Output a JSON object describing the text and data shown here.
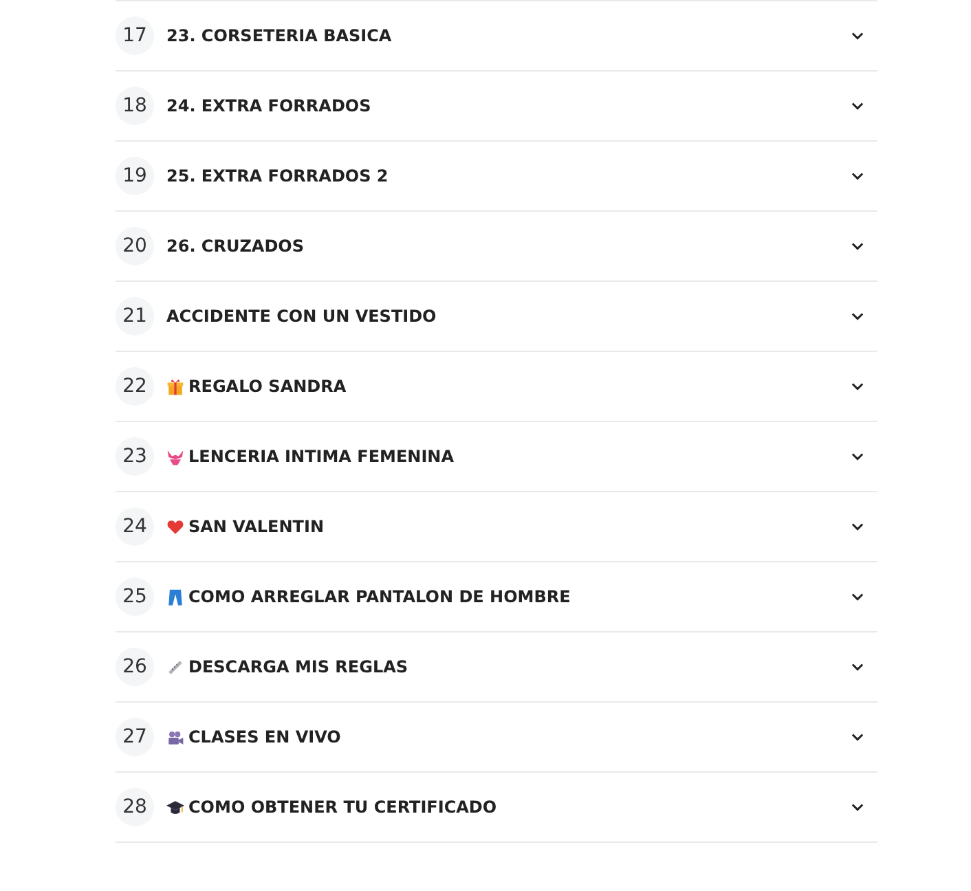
{
  "sections": [
    {
      "number": "17",
      "title": "23. CORSETERIA BASICA",
      "expanded": false
    },
    {
      "number": "18",
      "title": "24. EXTRA FORRADOS",
      "expanded": false
    },
    {
      "number": "19",
      "title": "25. EXTRA FORRADOS 2",
      "expanded": false
    },
    {
      "number": "20",
      "title": "26. CRUZADOS",
      "expanded": false
    },
    {
      "number": "21",
      "title": "ACCIDENTE CON UN VESTIDO",
      "expanded": false
    },
    {
      "number": "22",
      "kind": "gift",
      "title": "REGALO SANDRA",
      "expanded": false
    },
    {
      "number": "23",
      "kind": "lingerie",
      "title": "LENCERIA INTIMA FEMENINA",
      "expanded": false
    },
    {
      "number": "24",
      "kind": "heart",
      "title": "SAN VALENTIN",
      "expanded": false
    },
    {
      "number": "25",
      "kind": "jeans",
      "title": "COMO ARREGLAR PANTALON DE HOMBRE",
      "expanded": false
    },
    {
      "number": "26",
      "kind": "ruler",
      "title": "DESCARGA MIS REGLAS",
      "expanded": false
    },
    {
      "number": "27",
      "kind": "camera",
      "title": "CLASES EN VIVO",
      "expanded": false
    },
    {
      "number": "28",
      "kind": "cap",
      "title": "COMO OBTENER TU CERTIFICADO",
      "expanded": false
    }
  ]
}
